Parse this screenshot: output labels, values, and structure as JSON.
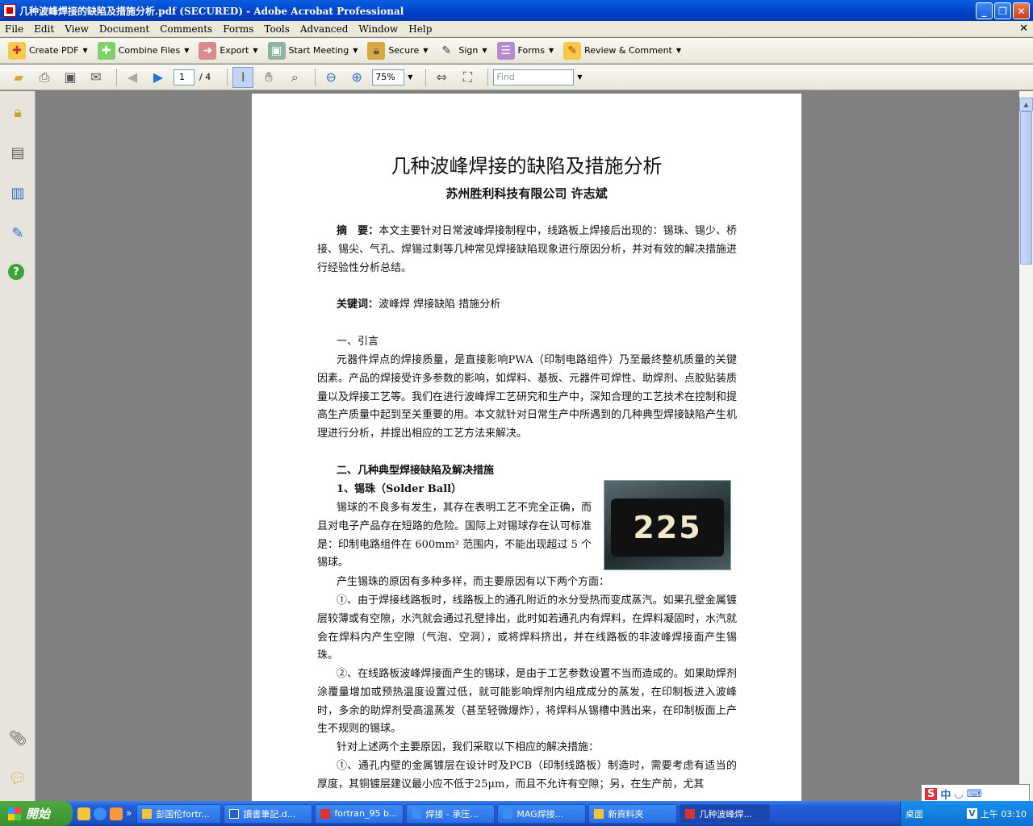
{
  "window": {
    "title": "几种波峰焊接的缺陷及措施分析.pdf (SECURED) - Adobe Acrobat Professional"
  },
  "menu": [
    "File",
    "Edit",
    "View",
    "Document",
    "Comments",
    "Forms",
    "Tools",
    "Advanced",
    "Window",
    "Help"
  ],
  "toolbar": {
    "buttons": [
      "Create PDF",
      "Combine Files",
      "Export",
      "Start Meeting",
      "Secure",
      "Sign",
      "Forms",
      "Review & Comment"
    ]
  },
  "nav": {
    "page_current": "1",
    "page_total": "/ 4",
    "zoom": "75%",
    "find_placeholder": "Find"
  },
  "document": {
    "title": "几种波峰焊接的缺陷及措施分析",
    "author": "苏州胜利科技有限公司   许志斌",
    "abstract_label": "摘　要：",
    "abstract": "本文主要针对日常波峰焊接制程中，线路板上焊接后出现的：锡珠、锡少、桥接、锡尖、气孔、焊锡过剩等几种常见焊接缺陷现象进行原因分析，并对有效的解决措施进行经验性分析总结。",
    "keywords_label": "关键词：",
    "keywords": "波峰焊  焊接缺陷  措施分析",
    "sec1_title": "一、引言",
    "sec1_para": "元器件焊点的焊接质量，是直接影响PWA（印制电路组件）乃至最终整机质量的关键因素。产品的焊接受许多参数的影响，如焊料、基板、元器件可焊性、助焊剂、点胶贴装质量以及焊接工艺等。我们在进行波峰焊工艺研究和生产中，深知合理的工艺技术在控制和提高生产质量中起到至关重要的用。本文就针对日常生产中所遇到的几种典型焊接缺陷产生机理进行分析，并提出相应的工艺方法来解决。",
    "sec2_title": "二、几种典型焊接缺陷及解决措施",
    "sub1_title": "1、锡珠（Solder Ball）",
    "sub1_p1": "锡球的不良多有发生，其存在表明工艺不完全正确，而且对电子产品存在短路的危险。国际上对锡球存在认可标准是：印制电路组件在 600mm² 范围内，不能出现超过 5 个锡球。",
    "sub1_p2": "产生锡珠的原因有多种多样，而主要原因有以下两个方面：",
    "sub1_p3": "①、由于焊接线路板时，线路板上的通孔附近的水分受热而变成蒸汽。如果孔壁金属镀层较薄或有空隙，水汽就会通过孔壁排出，此时如若通孔内有焊料，在焊料凝固时，水汽就会在焊料内产生空隙（气泡、空洞），或将焊料挤出，并在线路板的非波峰焊接面产生锡珠。",
    "sub1_p4": "②、在线路板波峰焊接面产生的锡球，是由于工艺参数设置不当而造成的。如果助焊剂涂覆量增加或预热温度设置过低，就可能影响焊剂内组成成分的蒸发，在印制板进入波峰时，多余的助焊剂受高温蒸发（甚至轻微爆炸），将焊料从锡槽中溅出来，在印制板面上产生不规则的锡球。",
    "sub1_p5": "针对上述两个主要原因，我们采取以下相应的解决措施：",
    "sub1_p6": "①、通孔内壁的金属镀层在设计时及PCB（印制线路板）制造时，需要考虑有适当的厚度，其铜镀层建议最小应不低于25μm，而且不允许有空隙；另，在生产前，尤其",
    "figure_label": "225"
  },
  "taskbar": {
    "start": "開始",
    "items": [
      "彭国伦fortr...",
      "讀書筆記.d...",
      "fortran_95 b...",
      "焊接 - 承压...",
      "MAG焊接...",
      "新資料夾",
      "几种波峰焊..."
    ],
    "tray_text": "桌面",
    "clock": "上午 03:10"
  },
  "colors": {
    "accent": "#0a5fe0",
    "taskbar": "#245edb"
  }
}
